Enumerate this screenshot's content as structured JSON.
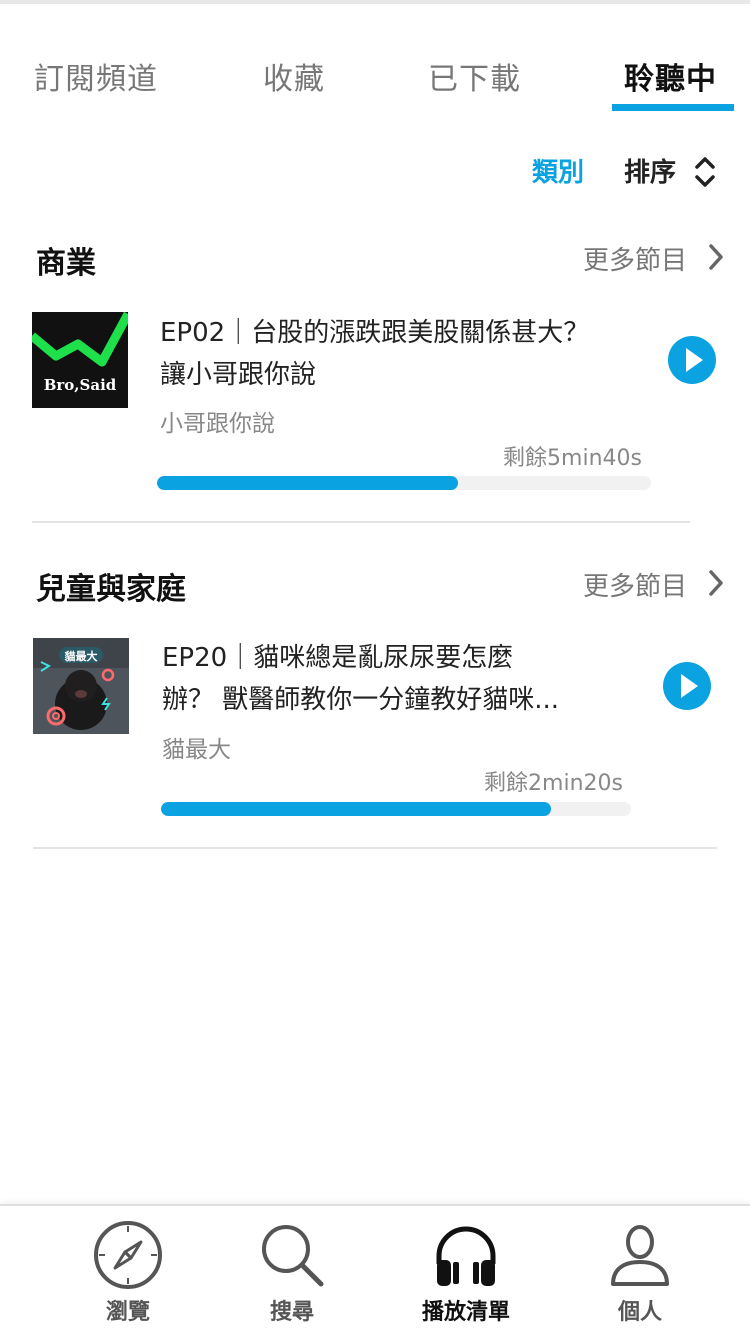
{
  "tabs": [
    {
      "label": "訂閱頻道"
    },
    {
      "label": "收藏"
    },
    {
      "label": "已下載"
    },
    {
      "label": "聆聽中"
    }
  ],
  "filter": {
    "category_label": "類別",
    "sort_label": "排序"
  },
  "sections": [
    {
      "title": "商業",
      "more_label": "更多節目",
      "episodes": [
        {
          "title_line1": "EP02｜台股的漲跌跟美股關係甚大？",
          "title_line2": "讓小哥跟你說",
          "channel": "小哥跟你說",
          "remaining": "剩餘5min40s",
          "progress": 0.61,
          "thumb_text": "Bro,Said"
        }
      ]
    },
    {
      "title": "兒童與家庭",
      "more_label": "更多節目",
      "episodes": [
        {
          "title_line1": "EP20｜貓咪總是亂尿尿要怎麼",
          "title_line2": "辦？ 獸醫師教你一分鐘教好貓咪...",
          "channel": "貓最大",
          "remaining": "剩餘2min20s",
          "progress": 0.83,
          "thumb_text": "貓最大"
        }
      ]
    }
  ],
  "bottom_nav": [
    {
      "label": "瀏覽",
      "icon": "compass-icon"
    },
    {
      "label": "搜尋",
      "icon": "search-icon"
    },
    {
      "label": "播放清單",
      "icon": "headphones-icon"
    },
    {
      "label": "個人",
      "icon": "person-icon"
    }
  ],
  "colors": {
    "accent": "#0aa2e0",
    "text": "#222222",
    "muted": "#888888"
  }
}
